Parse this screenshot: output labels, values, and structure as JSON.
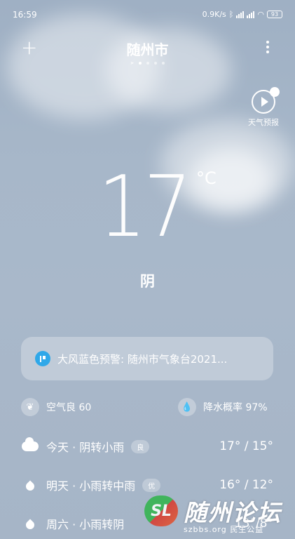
{
  "status_bar": {
    "time": "16:59",
    "net_speed": "0.9K/s",
    "battery": "93"
  },
  "header": {
    "add_label": "+",
    "city": "随州市",
    "page_count": 5,
    "active_page": 1
  },
  "forecast_video": {
    "label": "天气预报",
    "icon": "play-weather-icon"
  },
  "current": {
    "temperature": "17",
    "unit": "°C",
    "condition": "阴"
  },
  "alert": {
    "text": "大风蓝色预警: 随州市气象台2021...",
    "icon": "warning-flag-icon",
    "icon_color": "#2fa8e9"
  },
  "stats": {
    "air_quality": "空气良 60",
    "rain_probability": "降水概率 97%"
  },
  "daily": [
    {
      "day_desc": "今天 · 阴转小雨",
      "aqi": "良",
      "range": "17° / 15°",
      "icon": "cloud-icon"
    },
    {
      "day_desc": "明天 · 小雨转中雨",
      "aqi": "优",
      "range": "16° / 12°",
      "icon": "raindrop-icon"
    },
    {
      "day_desc": "周六 · 小雨转阴",
      "aqi": "",
      "range": "13°/8°",
      "icon": "raindrop-icon"
    }
  ],
  "watermark": {
    "logo_text": "SL",
    "name": "随州论坛",
    "sub": "szbbs.org 民生公益"
  }
}
